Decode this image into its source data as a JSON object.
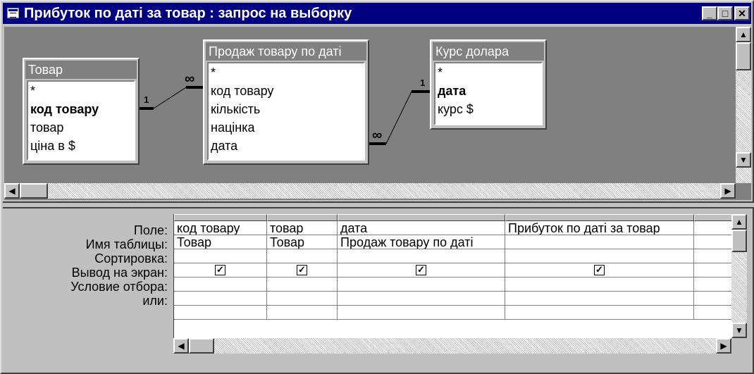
{
  "window": {
    "title": "Прибуток по даті за товар : запрос на выборку",
    "minimize": "_",
    "maximize": "□",
    "close": "✕"
  },
  "tables": [
    {
      "title": "Товар",
      "fields": [
        {
          "name": "*",
          "bold": false
        },
        {
          "name": "код товару",
          "bold": true
        },
        {
          "name": "товар",
          "bold": false
        },
        {
          "name": "ціна в $",
          "bold": false
        }
      ]
    },
    {
      "title": "Продаж товару по даті",
      "fields": [
        {
          "name": "*",
          "bold": false
        },
        {
          "name": "код товару",
          "bold": false
        },
        {
          "name": "кількість",
          "bold": false
        },
        {
          "name": "націнка",
          "bold": false
        },
        {
          "name": "дата",
          "bold": false
        }
      ]
    },
    {
      "title": "Курс долара",
      "fields": [
        {
          "name": "*",
          "bold": false
        },
        {
          "name": "дата",
          "bold": true
        },
        {
          "name": "курс $",
          "bold": false
        }
      ]
    }
  ],
  "relations": [
    {
      "one_label": "1",
      "many_label": "∞"
    },
    {
      "one_label": "1",
      "many_label": "∞"
    }
  ],
  "grid": {
    "row_labels": [
      "Поле:",
      "Имя таблицы:",
      "Сортировка:",
      "Вывод на экран:",
      "Условие отбора:",
      "или:"
    ],
    "columns": [
      {
        "field": "код товару",
        "table": "Товар",
        "sort": "",
        "show": true
      },
      {
        "field": "товар",
        "table": "Товар",
        "sort": "",
        "show": true
      },
      {
        "field": "дата",
        "table": "Продаж товару по даті",
        "sort": "",
        "show": true
      },
      {
        "field": "Прибуток по даті за товар",
        "table": "",
        "sort": "",
        "show": true
      },
      {
        "field": "",
        "table": "",
        "sort": "",
        "show": false
      }
    ]
  },
  "icons": {
    "window": "query-icon",
    "scroll_up": "arrow-up-icon",
    "scroll_down": "arrow-down-icon",
    "scroll_left": "arrow-left-icon",
    "scroll_right": "arrow-right-icon",
    "check": "checkmark-icon"
  },
  "colors": {
    "titlebar": "#000080",
    "table_header": "#808080",
    "face": "#c0c0c0"
  }
}
